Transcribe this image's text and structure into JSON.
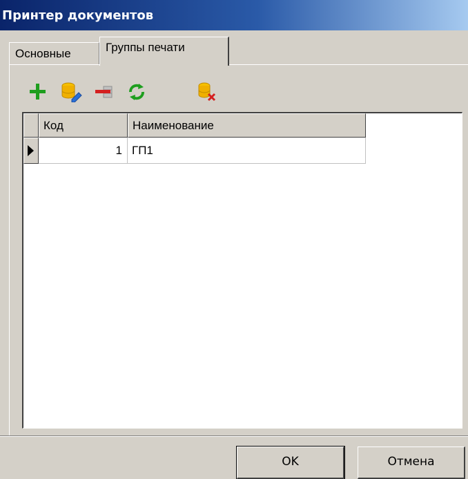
{
  "window": {
    "title": "Принтер документов"
  },
  "tabs": [
    {
      "label": "Основные",
      "active": false
    },
    {
      "label": "Группы печати",
      "active": true
    }
  ],
  "toolbar": [
    {
      "icon": "plus-icon",
      "color": "#1e9e1e"
    },
    {
      "icon": "database-edit-icon",
      "color": "#e8a800"
    },
    {
      "icon": "remove-row-icon",
      "color": "#d42020"
    },
    {
      "icon": "refresh-icon",
      "color": "#1e9e1e"
    },
    {
      "icon": "database-delete-icon",
      "color": "#e8a800"
    }
  ],
  "grid": {
    "columns": [
      "Код",
      "Наименование"
    ],
    "rows": [
      {
        "code": "1",
        "name": "ГП1",
        "current": true
      }
    ]
  },
  "buttons": {
    "ok": "OK",
    "cancel": "Отмена"
  }
}
